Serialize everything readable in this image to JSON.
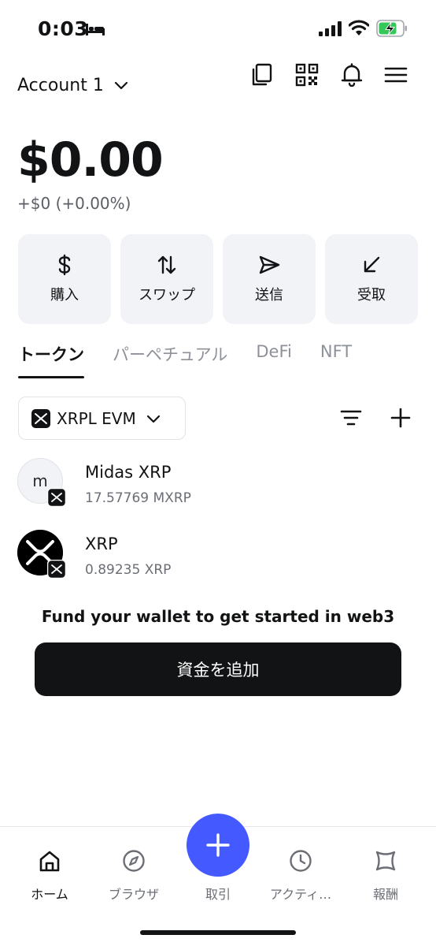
{
  "status_bar": {
    "time": "0:03",
    "icons": [
      "bed-icon",
      "signal-icon",
      "wifi-icon",
      "battery-charging-icon"
    ]
  },
  "header": {
    "account": "Account 1",
    "icons": [
      "copy-icon",
      "qr-code-icon",
      "bell-icon",
      "menu-icon"
    ]
  },
  "balance": {
    "total": "$0.00",
    "change": "+$0 (+0.00%)"
  },
  "actions": [
    {
      "label": "購入",
      "icon": "dollar-icon"
    },
    {
      "label": "スワップ",
      "icon": "swap-icon"
    },
    {
      "label": "送信",
      "icon": "send-icon"
    },
    {
      "label": "受取",
      "icon": "receive-icon"
    }
  ],
  "tabs": [
    {
      "label": "トークン",
      "active": true
    },
    {
      "label": "パーペチュアル",
      "active": false
    },
    {
      "label": "DeFi",
      "active": false
    },
    {
      "label": "NFT",
      "active": false
    }
  ],
  "network": {
    "name": "XRPL EVM"
  },
  "tokens": [
    {
      "avatar_letter": "m",
      "name": "Midas XRP",
      "amount": "17.57769 MXRP"
    },
    {
      "avatar_letter": "",
      "name": "XRP",
      "amount": "0.89235 XRP"
    }
  ],
  "fund": {
    "text": "Fund your wallet to get started in web3",
    "button": "資金を追加"
  },
  "bottom_nav": [
    {
      "label": "ホーム",
      "icon": "home-icon",
      "active": true
    },
    {
      "label": "ブラウザ",
      "icon": "compass-icon",
      "active": false
    },
    {
      "label": "取引",
      "icon": "plus-icon",
      "active": false
    },
    {
      "label": "アクティ…",
      "icon": "clock-icon",
      "active": false
    },
    {
      "label": "報酬",
      "icon": "rewards-icon",
      "active": false
    }
  ],
  "colors": {
    "accent": "#4459ff",
    "text_primary": "#121314",
    "text_secondary": "#6b6e75",
    "card_bg": "#f2f3f7"
  }
}
